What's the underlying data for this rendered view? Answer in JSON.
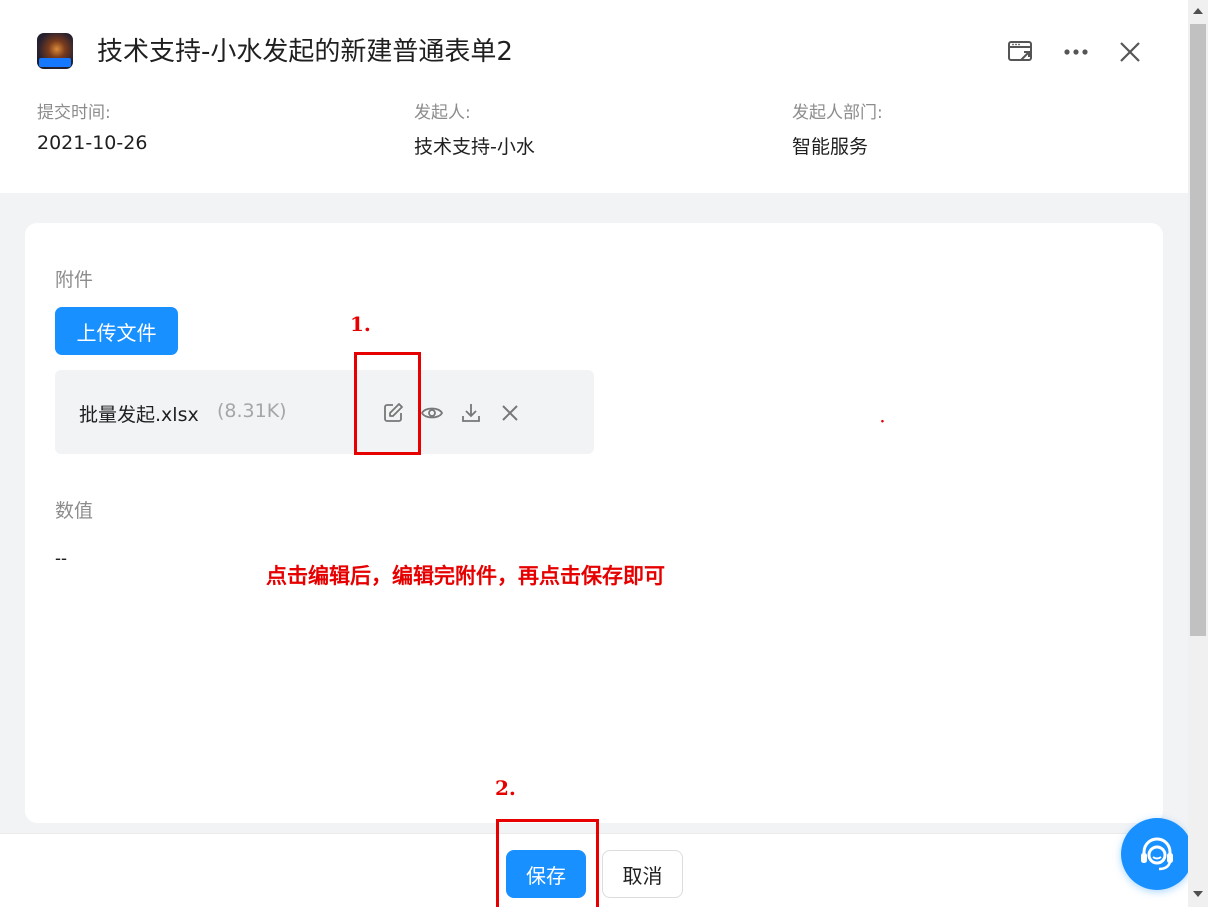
{
  "header": {
    "title": "技术支持-小水发起的新建普通表单2",
    "meta": [
      {
        "label": "提交时间:",
        "value": "2021-10-26"
      },
      {
        "label": "发起人:",
        "value": "技术支持-小水"
      },
      {
        "label": "发起人部门:",
        "value": "智能服务"
      }
    ],
    "icons": [
      "open-in-window-icon",
      "more-icon",
      "close-icon"
    ]
  },
  "form": {
    "attachment": {
      "label": "附件",
      "upload_label": "上传文件",
      "file": {
        "name": "批量发起.xlsx",
        "size": "(8.31K)"
      },
      "actions": [
        "edit-icon",
        "preview-eye-icon",
        "download-icon",
        "remove-icon"
      ]
    },
    "number_field": {
      "label": "数值",
      "value": "--"
    }
  },
  "annotations": {
    "step1": "1.",
    "step2": "2.",
    "instruction": "点击编辑后，编辑完附件，再点击保存即可",
    "highlight_color": "#e60000"
  },
  "footer": {
    "save_label": "保存",
    "cancel_label": "取消"
  },
  "colors": {
    "primary": "#1890ff",
    "page_bg": "#f2f3f5",
    "annotation": "#e60000"
  }
}
